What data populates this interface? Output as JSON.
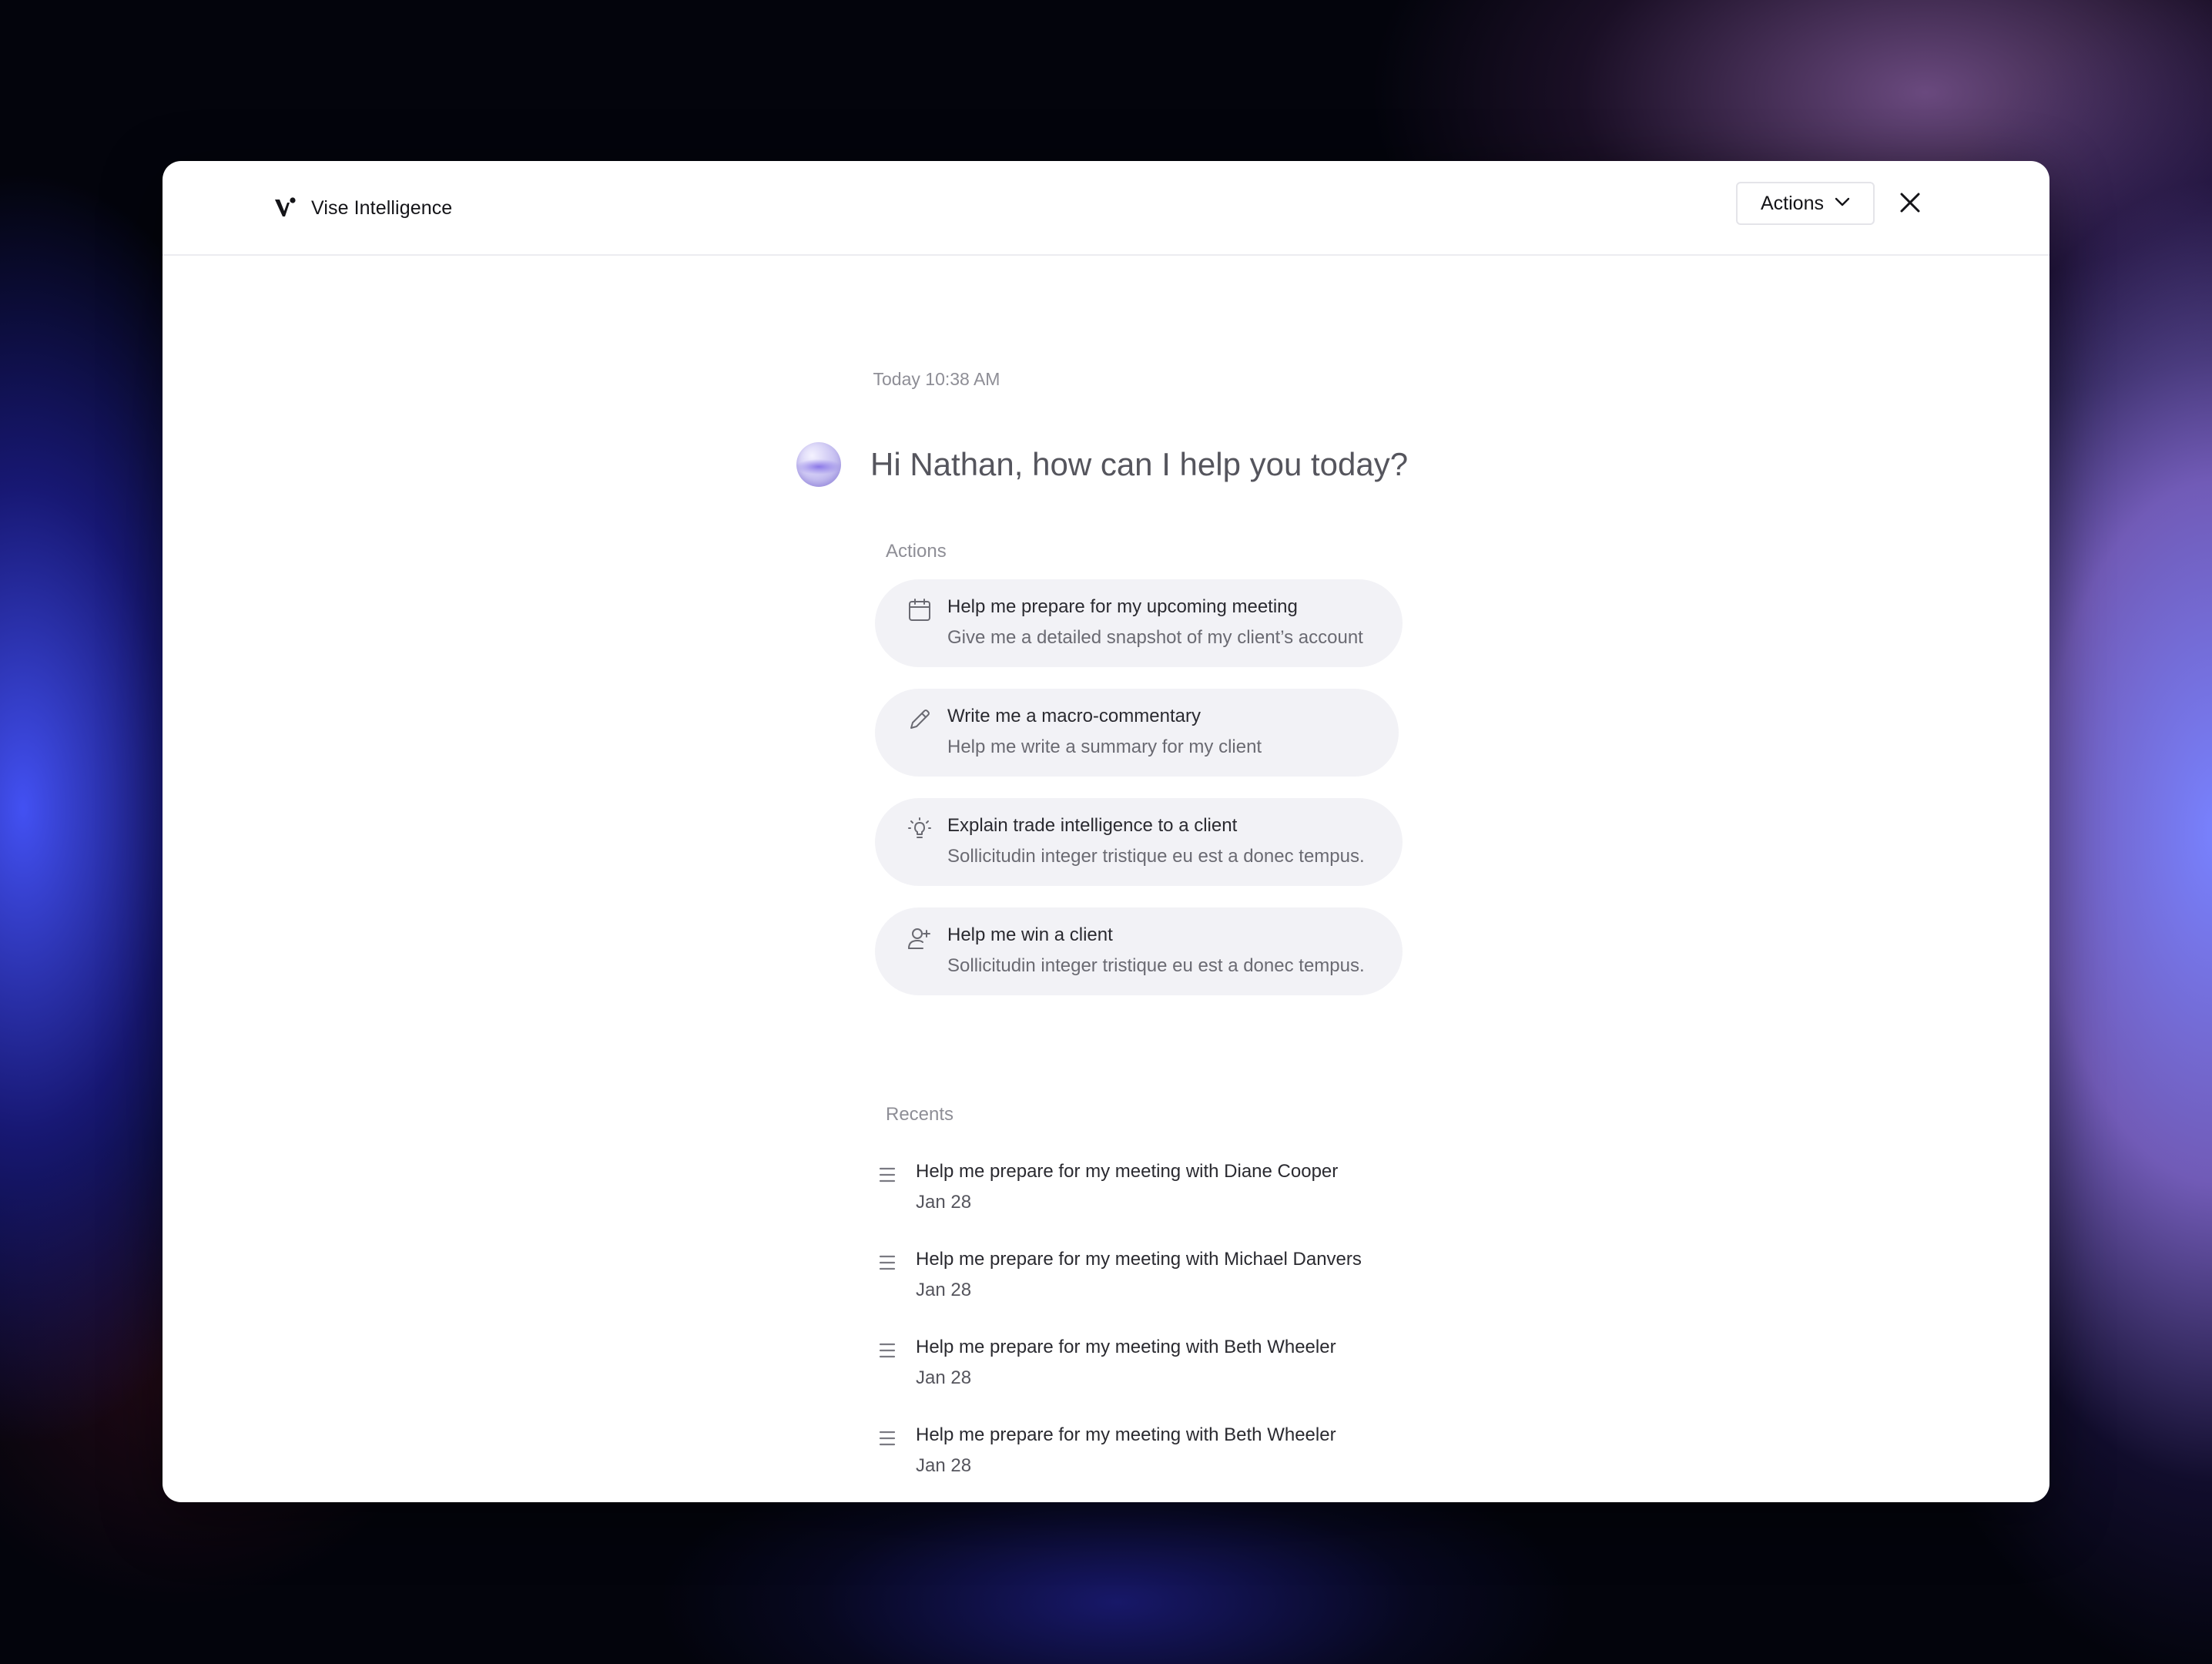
{
  "header": {
    "app_title": "Vise Intelligence",
    "actions_label": "Actions"
  },
  "chat": {
    "timestamp": "Today 10:38 AM",
    "greeting": "Hi Nathan, how can I help you today?"
  },
  "actions": {
    "section_label": "Actions",
    "items": [
      {
        "icon": "calendar-icon",
        "title": "Help me prepare for my upcoming meeting",
        "subtitle": "Give me a detailed snapshot of my client’s account"
      },
      {
        "icon": "pencil-icon",
        "title": "Write me a macro-commentary",
        "subtitle": "Help me write a summary for my client"
      },
      {
        "icon": "lightbulb-icon",
        "title": "Explain trade intelligence to a client",
        "subtitle": "Sollicitudin integer tristique eu est a donec tempus."
      },
      {
        "icon": "add-user-icon",
        "title": "Help me win a client",
        "subtitle": "Sollicitudin integer tristique eu est a donec tempus."
      }
    ]
  },
  "recents": {
    "section_label": "Recents",
    "items": [
      {
        "icon": "list-icon",
        "title": "Help me prepare for my meeting with Diane Cooper",
        "date": "Jan 28"
      },
      {
        "icon": "list-icon",
        "title": "Help me prepare for my meeting with Michael Danvers",
        "date": "Jan 28"
      },
      {
        "icon": "list-icon",
        "title": "Help me prepare for my meeting with Beth Wheeler",
        "date": "Jan 28"
      },
      {
        "icon": "list-icon",
        "title": "Help me prepare for my meeting with Beth Wheeler",
        "date": "Jan 28"
      }
    ]
  }
}
